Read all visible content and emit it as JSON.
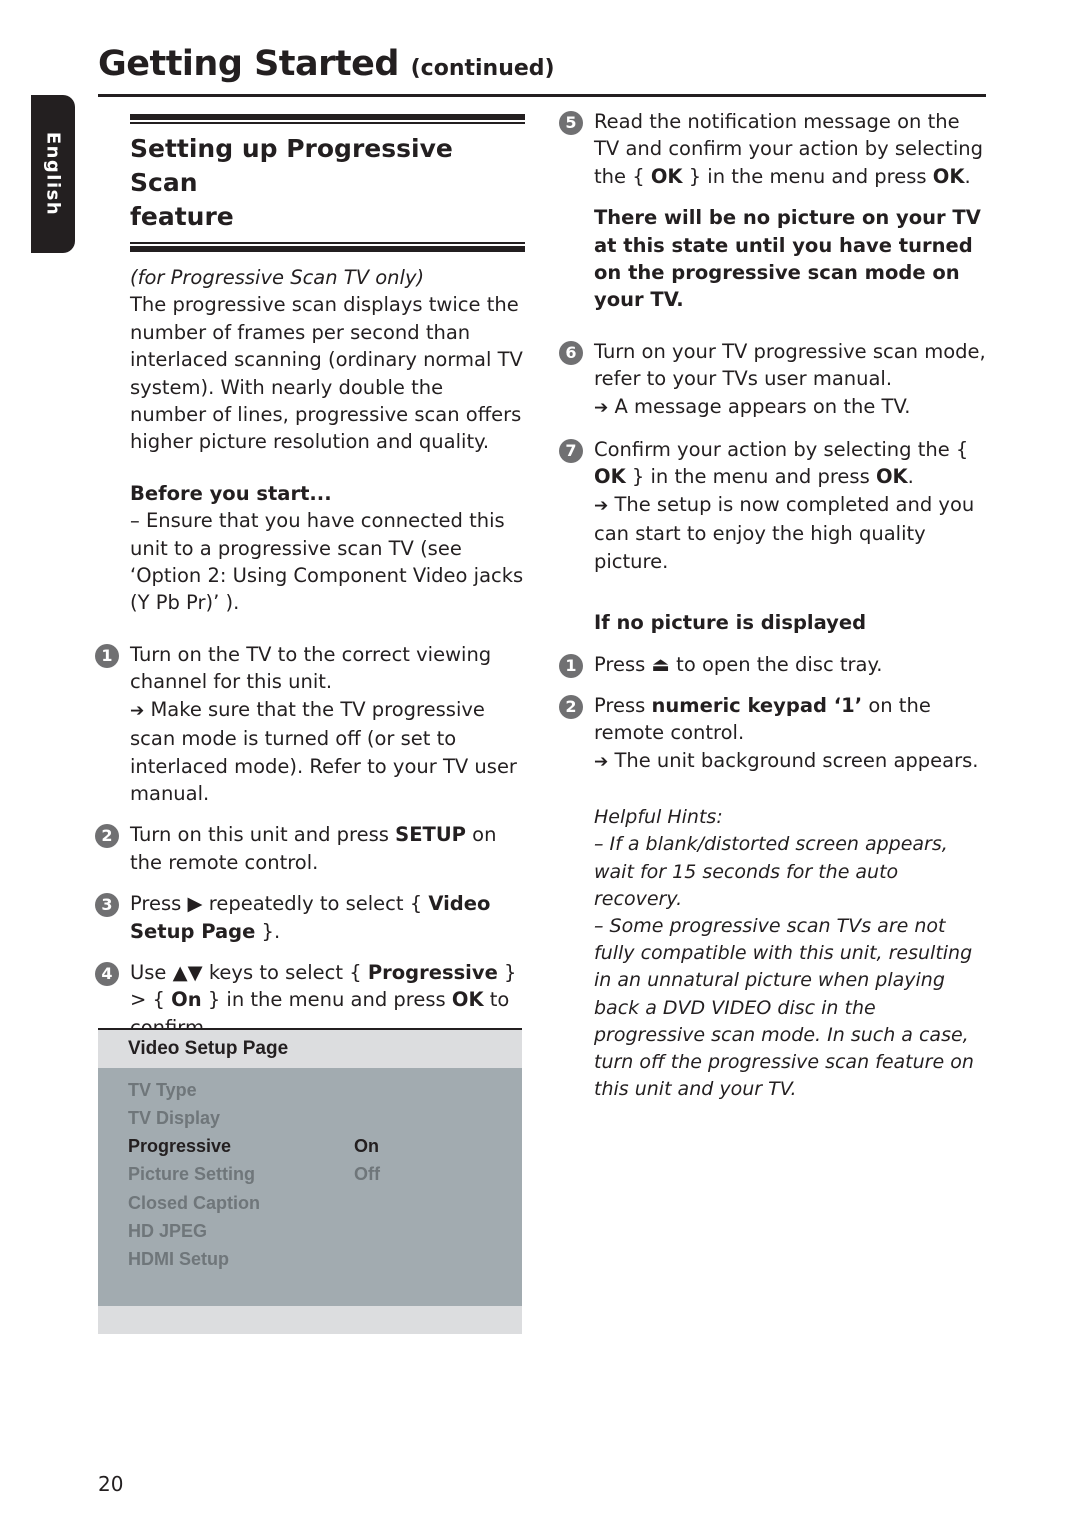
{
  "header": {
    "title": "Getting Started",
    "subtitle": "(continued)"
  },
  "language_tab": "English",
  "section": {
    "title_line1": "Setting up Progressive Scan",
    "title_line2": "feature",
    "note": "(for Progressive Scan TV only)",
    "intro": "The progressive scan displays twice the number of frames per second than interlaced scanning (ordinary normal TV system). With nearly double the number of lines, progressive scan offers higher picture resolution and quality.",
    "before_heading": "Before you start...",
    "before_text": "–  Ensure that you have connected this unit to a progressive scan TV (see ‘Option 2: Using Component Video jacks (Y Pb Pr)’ )."
  },
  "steps": [
    {
      "num": "1",
      "parts": [
        "Turn on the TV to the correct viewing channel for this unit."
      ],
      "result": "Make sure that the TV progressive scan mode is turned off (or set to interlaced mode). Refer to your TV user manual."
    },
    {
      "num": "2",
      "pre": "Turn on this unit and press ",
      "bold": "SETUP",
      "post": " on the remote control."
    },
    {
      "num": "3",
      "pre": "Press ",
      "icon": "▶",
      "mid": " repeatedly to select { ",
      "bold": "Video Setup Page",
      "post": " }."
    },
    {
      "num": "4",
      "pre": "Use ",
      "icon": "▲▼",
      "mid": " keys to select { ",
      "bold1": "Progressive",
      "mid2": " } > { ",
      "bold2": "On",
      "mid3": " } in the menu and press ",
      "bold3": "OK",
      "post": " to confirm."
    },
    {
      "num": "5",
      "pre": "Read the notification message on the TV and confirm your action by selecting the { ",
      "bold1": "OK",
      "mid": " } in the menu and press ",
      "bold2": "OK",
      "post": ".",
      "warning": "There will be no picture on your TV at this state until you have turned on the progressive scan mode on your TV."
    },
    {
      "num": "6",
      "text": "Turn on your TV progressive scan mode, refer to your TVs user manual.",
      "result": "A message appears on the TV."
    },
    {
      "num": "7",
      "pre": "Confirm your action by selecting the { ",
      "bold1": "OK",
      "mid": " } in the menu and press ",
      "bold2": "OK",
      "post": ".",
      "result": "The setup is now completed and you can start to enjoy the high quality picture."
    }
  ],
  "no_picture": {
    "heading": "If no picture is displayed",
    "steps": [
      {
        "num": "1",
        "pre": "Press ",
        "icon": "⏏",
        "post": " to open the disc tray."
      },
      {
        "num": "2",
        "pre": "Press ",
        "bold": "numeric keypad ‘1’",
        "post": " on the remote control.",
        "result": "The unit background screen appears."
      }
    ]
  },
  "hints": {
    "title": "Helpful Hints:",
    "items": [
      "–  If a blank/distorted screen appears, wait for 15 seconds for the auto recovery.",
      "–  Some progressive scan TVs are not fully compatible with this unit, resulting in an unnatural picture when playing back a DVD VIDEO disc in the progressive scan mode. In such a case, turn off the progressive scan feature on this unit and your TV."
    ]
  },
  "menu": {
    "title": "Video Setup Page",
    "items": [
      "TV Type",
      "TV Display",
      "Progressive",
      "Picture Setting",
      "Closed Caption",
      "HD JPEG",
      "HDMI Setup"
    ],
    "selected_item": "Progressive",
    "options": [
      "On",
      "Off"
    ],
    "selected_option": "On"
  },
  "arrow_glyph": "➔",
  "page_number": "20"
}
